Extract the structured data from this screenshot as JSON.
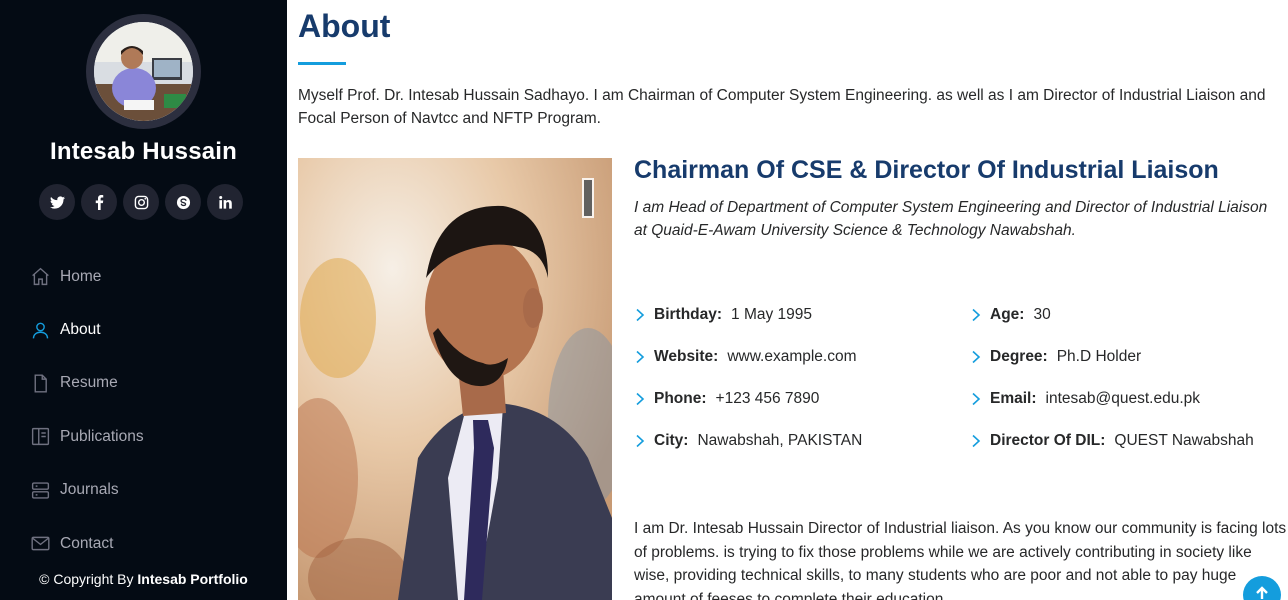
{
  "sidebar": {
    "profile_name": "Intesab Hussain",
    "social": [
      {
        "name": "twitter",
        "icon": "twitter-icon"
      },
      {
        "name": "facebook",
        "icon": "facebook-icon"
      },
      {
        "name": "instagram",
        "icon": "instagram-icon"
      },
      {
        "name": "skype",
        "icon": "skype-icon"
      },
      {
        "name": "linkedin",
        "icon": "linkedin-icon"
      }
    ],
    "nav": [
      {
        "label": "Home",
        "icon": "home-icon",
        "active": false
      },
      {
        "label": "About",
        "icon": "person-icon",
        "active": true
      },
      {
        "label": "Resume",
        "icon": "file-icon",
        "active": false
      },
      {
        "label": "Publications",
        "icon": "book-icon",
        "active": false
      },
      {
        "label": "Journals",
        "icon": "server-icon",
        "active": false
      },
      {
        "label": "Contact",
        "icon": "envelope-icon",
        "active": false
      }
    ],
    "copyright_prefix": "© Copyright By",
    "copyright_brand": "Intesab Portfolio"
  },
  "about": {
    "title": "About",
    "intro": "Myself Prof. Dr. Intesab Hussain Sadhayo. I am Chairman of Computer System Engineering. as well as I am Director of Industrial Liaison and Focal Person of Navtcc and NFTP Program.",
    "role_title": "Chairman Of CSE & Director Of Industrial Liaison",
    "role_desc": "I am Head of Department of Computer System Engineering and Director of Industrial Liaison at Quaid-E-Awam University Science & Technology Nawabshah.",
    "facts_left": [
      {
        "key": "Birthday:",
        "value": "1 May 1995"
      },
      {
        "key": "Website:",
        "value": "www.example.com"
      },
      {
        "key": "Phone:",
        "value": "+123 456 7890"
      },
      {
        "key": "City:",
        "value": "Nawabshah, PAKISTAN"
      }
    ],
    "facts_right": [
      {
        "key": "Age:",
        "value": "30"
      },
      {
        "key": "Degree:",
        "value": "Ph.D Holder"
      },
      {
        "key": "Email:",
        "value": "intesab@quest.edu.pk"
      },
      {
        "key": "Director Of DIL:",
        "value": "QUEST Nawabshah"
      }
    ],
    "bio": "I am Dr. Intesab Hussain Director of Industrial liaison. As you know our community is facing lots of problems. is trying to fix those problems while we are actively contributing in society like wise, providing technical skills, to many students who are poor and not able to pay huge amount of feeses to complete their education."
  },
  "colors": {
    "sidebar_bg": "#040b14",
    "accent": "#149ddd",
    "heading": "#173b6c"
  }
}
